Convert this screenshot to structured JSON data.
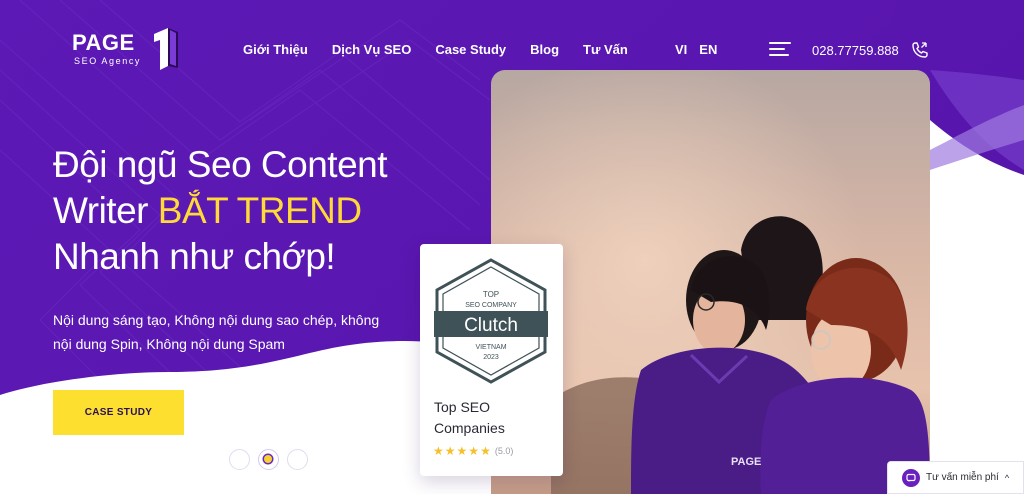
{
  "brand": {
    "name": "PAGE",
    "tagline": "SEO Agency",
    "mark": "1"
  },
  "nav": {
    "items": [
      "Giới Thiệu",
      "Dịch Vụ SEO",
      "Case Study",
      "Blog",
      "Tư Vấn"
    ]
  },
  "lang": {
    "vi": "VI",
    "en": "EN"
  },
  "phone": "028.77759.888",
  "hero": {
    "title_part1": "Đội ngũ Seo Content Writer ",
    "title_highlight": "BẮT TREND",
    "title_part2": " Nhanh như chớp!",
    "subtitle": "Nội dung sáng tạo, Không nội dung sao chép, không nội dung Spin, Không nội dung Spam",
    "cta": "CASE STUDY"
  },
  "carousel": {
    "count": 3,
    "active": 1
  },
  "award": {
    "badge_top": "TOP",
    "badge_sub": "SEO COMPANY",
    "badge_brand": "Clutch",
    "badge_country": "VIETNAM",
    "badge_year": "2023",
    "title": "Top SEO Companies",
    "stars": 5,
    "rating": "(5.0)"
  },
  "chat": {
    "label": "Tư vấn miễn phí",
    "caret": "^"
  },
  "colors": {
    "brand_purple": "#5a17b0",
    "accent_yellow": "#fde02f",
    "highlight": "#ffd93a"
  }
}
